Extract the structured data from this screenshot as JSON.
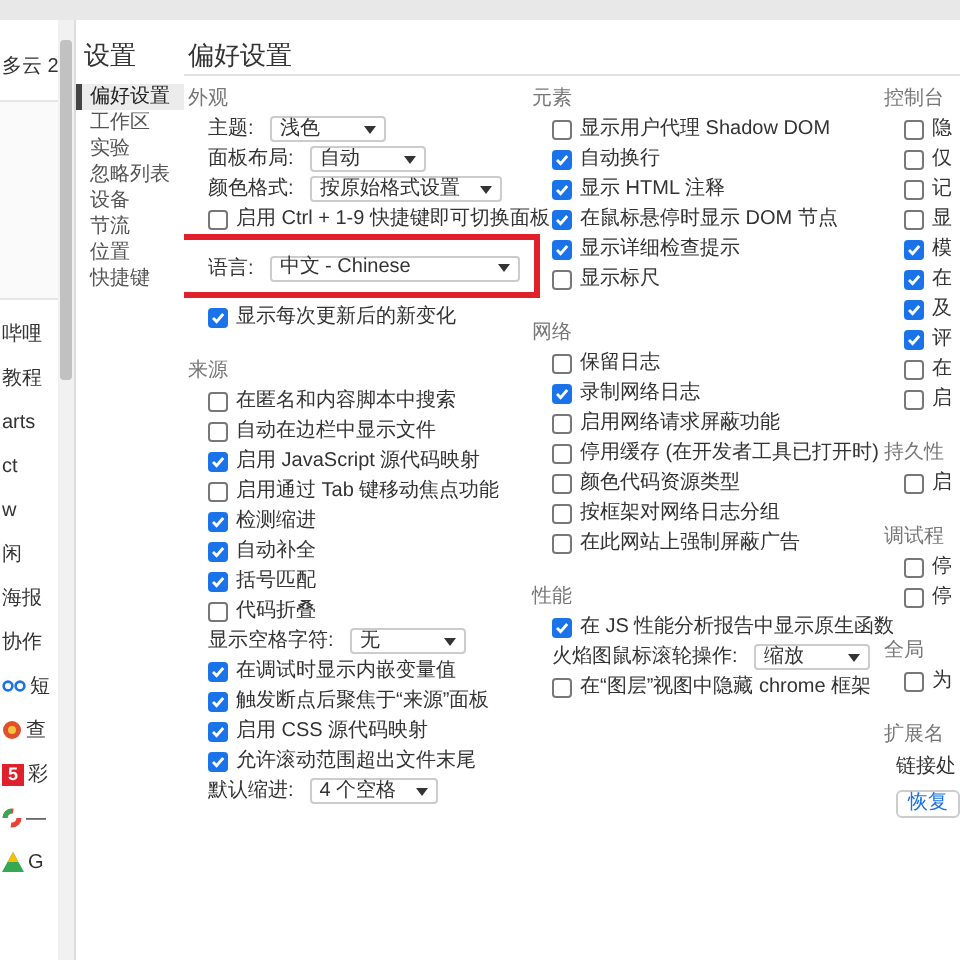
{
  "left_strip": {
    "items": [
      {
        "kind": "text",
        "text": "多云 2"
      },
      {
        "kind": "text",
        "text": "哔哩"
      },
      {
        "kind": "text",
        "text": "教程"
      },
      {
        "kind": "text",
        "text": "arts"
      },
      {
        "kind": "text",
        "text": "ct"
      },
      {
        "kind": "text",
        "text": "w"
      },
      {
        "kind": "text",
        "text": "闲"
      },
      {
        "kind": "text",
        "text": "海报"
      },
      {
        "kind": "text",
        "text": "协作"
      },
      {
        "kind": "chain",
        "text": "短"
      },
      {
        "kind": "emblem",
        "text": "查"
      },
      {
        "kind": "number",
        "icon_text": "5",
        "text": "彩"
      },
      {
        "kind": "ring",
        "text": "—"
      },
      {
        "kind": "triangle",
        "text": "G"
      }
    ]
  },
  "settings_nav": {
    "title": "设置",
    "items": [
      {
        "label": "偏好设置",
        "selected": true
      },
      {
        "label": "工作区",
        "selected": false
      },
      {
        "label": "实验",
        "selected": false
      },
      {
        "label": "忽略列表",
        "selected": false
      },
      {
        "label": "设备",
        "selected": false
      },
      {
        "label": "节流",
        "selected": false
      },
      {
        "label": "位置",
        "selected": false
      },
      {
        "label": "快捷键",
        "selected": false
      }
    ]
  },
  "page_title": "偏好设置",
  "columns": [
    [
      {
        "title": "外观",
        "items": [
          {
            "kind": "select",
            "label": "主题:",
            "value": "浅色"
          },
          {
            "kind": "select",
            "label": "面板布局:",
            "value": "自动"
          },
          {
            "kind": "select",
            "label": "颜色格式:",
            "value": "按原始格式设置"
          },
          {
            "kind": "checkbox",
            "label": "启用 Ctrl + 1-9 快捷键即可切换面板",
            "checked": false
          },
          {
            "kind": "select",
            "label": "语言:",
            "value": "中文 - Chinese",
            "highlighted": true
          },
          {
            "kind": "checkbox",
            "label": "显示每次更新后的新变化",
            "checked": true
          }
        ]
      },
      {
        "title": "来源",
        "items": [
          {
            "kind": "checkbox",
            "label": "在匿名和内容脚本中搜索",
            "checked": false
          },
          {
            "kind": "checkbox",
            "label": "自动在边栏中显示文件",
            "checked": false
          },
          {
            "kind": "checkbox",
            "label": "启用 JavaScript 源代码映射",
            "checked": true
          },
          {
            "kind": "checkbox",
            "label": "启用通过 Tab 键移动焦点功能",
            "checked": false
          },
          {
            "kind": "checkbox",
            "label": "检测缩进",
            "checked": true
          },
          {
            "kind": "checkbox",
            "label": "自动补全",
            "checked": true
          },
          {
            "kind": "checkbox",
            "label": "括号匹配",
            "checked": true
          },
          {
            "kind": "checkbox",
            "label": "代码折叠",
            "checked": false
          },
          {
            "kind": "select",
            "label": "显示空格字符:",
            "value": "无"
          },
          {
            "kind": "checkbox",
            "label": "在调试时显示内嵌变量值",
            "checked": true
          },
          {
            "kind": "checkbox",
            "label": "触发断点后聚焦于“来源”面板",
            "checked": true
          },
          {
            "kind": "checkbox",
            "label": "启用 CSS 源代码映射",
            "checked": true
          },
          {
            "kind": "checkbox",
            "label": "允许滚动范围超出文件末尾",
            "checked": true
          },
          {
            "kind": "select",
            "label": "默认缩进:",
            "value": "4 个空格"
          }
        ]
      }
    ],
    [
      {
        "title": "元素",
        "items": [
          {
            "kind": "checkbox",
            "label": "显示用户代理 Shadow DOM",
            "checked": false
          },
          {
            "kind": "checkbox",
            "label": "自动换行",
            "checked": true
          },
          {
            "kind": "checkbox",
            "label": "显示 HTML 注释",
            "checked": true
          },
          {
            "kind": "checkbox",
            "label": "在鼠标悬停时显示 DOM 节点",
            "checked": true
          },
          {
            "kind": "checkbox",
            "label": "显示详细检查提示",
            "checked": true
          },
          {
            "kind": "checkbox",
            "label": "显示标尺",
            "checked": false
          }
        ]
      },
      {
        "title": "网络",
        "items": [
          {
            "kind": "checkbox",
            "label": "保留日志",
            "checked": false
          },
          {
            "kind": "checkbox",
            "label": "录制网络日志",
            "checked": true
          },
          {
            "kind": "checkbox",
            "label": "启用网络请求屏蔽功能",
            "checked": false
          },
          {
            "kind": "checkbox",
            "label": "停用缓存 (在开发者工具已打开时)",
            "checked": false
          },
          {
            "kind": "checkbox",
            "label": "颜色代码资源类型",
            "checked": false
          },
          {
            "kind": "checkbox",
            "label": "按框架对网络日志分组",
            "checked": false
          },
          {
            "kind": "checkbox",
            "label": "在此网站上强制屏蔽广告",
            "checked": false
          }
        ]
      },
      {
        "title": "性能",
        "items": [
          {
            "kind": "checkbox",
            "label": "在 JS 性能分析报告中显示原生函数",
            "checked": true
          },
          {
            "kind": "select",
            "label": "火焰图鼠标滚轮操作:",
            "value": "缩放"
          },
          {
            "kind": "checkbox",
            "label": "在“图层”视图中隐藏 chrome 框架",
            "checked": false
          }
        ]
      }
    ],
    [
      {
        "title": "控制台",
        "items": [
          {
            "kind": "checkbox",
            "label": "隐",
            "checked": false
          },
          {
            "kind": "checkbox",
            "label": "仅",
            "checked": false
          },
          {
            "kind": "checkbox",
            "label": "记",
            "checked": false
          },
          {
            "kind": "checkbox",
            "label": "显",
            "checked": false
          },
          {
            "kind": "checkbox",
            "label": "模",
            "checked": true
          },
          {
            "kind": "checkbox",
            "label": "在",
            "checked": true
          },
          {
            "kind": "checkbox",
            "label": "及",
            "checked": true
          },
          {
            "kind": "checkbox",
            "label": "评",
            "checked": true
          },
          {
            "kind": "checkbox",
            "label": "在",
            "checked": false
          },
          {
            "kind": "checkbox",
            "label": "启",
            "checked": false
          }
        ]
      },
      {
        "title": "持久性",
        "items": [
          {
            "kind": "checkbox",
            "label": "启",
            "checked": false
          }
        ]
      },
      {
        "title": "调试程",
        "items": [
          {
            "kind": "checkbox",
            "label": "停",
            "checked": false
          },
          {
            "kind": "checkbox",
            "label": "停",
            "checked": false
          }
        ]
      },
      {
        "title": "全局",
        "items": [
          {
            "kind": "checkbox",
            "label": "为",
            "checked": false
          }
        ]
      },
      {
        "title": "扩展名",
        "items": [
          {
            "kind": "text",
            "label": "链接处"
          },
          {
            "kind": "button",
            "label": "恢复"
          }
        ]
      }
    ]
  ]
}
